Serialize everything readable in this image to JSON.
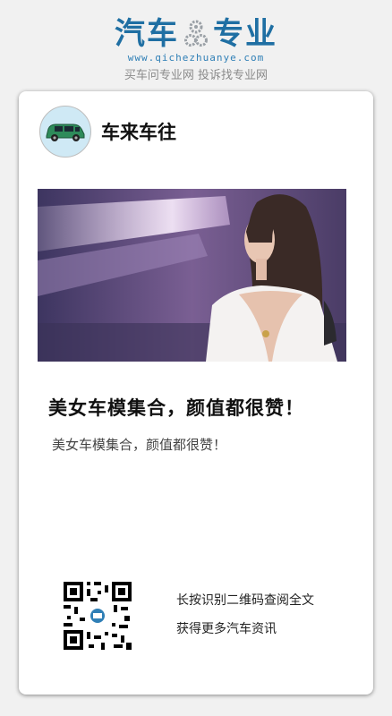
{
  "brand": {
    "left_word": "汽车",
    "right_word": "专业",
    "url": "www.qichezhuanye.com",
    "slogan": "买车问专业网 投诉找专业网",
    "color": "#1f6fa3"
  },
  "author": {
    "name": "车来车往",
    "avatar_icon": "green-car-icon"
  },
  "article": {
    "image": "car-model-photo",
    "title": "美女车模集合，颜值都很赞！",
    "excerpt": "美女车模集合，颜值都很赞！"
  },
  "qr": {
    "icon": "qr-code-icon",
    "line1": "长按识别二维码查阅全文",
    "line2": "获得更多汽车资讯"
  }
}
